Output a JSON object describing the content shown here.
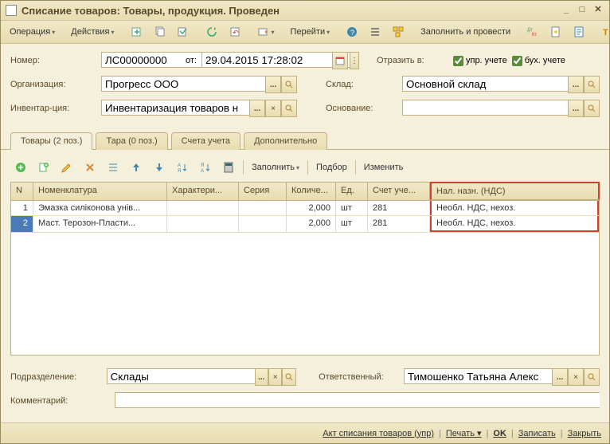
{
  "title": "Списание товаров: Товары, продукция. Проведен",
  "toolbar": {
    "operation": "Операция",
    "actions": "Действия",
    "goto": "Перейти",
    "fillpost": "Заполнить и провести"
  },
  "form": {
    "nomer_label": "Номер:",
    "nomer": "ЛС00000000",
    "ot_label": "от:",
    "date": "29.04.2015 17:28:02",
    "reflect_label": "Отразить в:",
    "chk_upr": "упр. учете",
    "chk_buh": "бух. учете",
    "org_label": "Организация:",
    "org": "Прогресс ООО",
    "sklad_label": "Склад:",
    "sklad": "Основной склад",
    "invent_label": "Инвентар-ция:",
    "invent": "Инвентаризация товаров н",
    "reason_label": "Основание:"
  },
  "tabs": {
    "goods": "Товары (2 поз.)",
    "tara": "Тара (0 поз.)",
    "accounts": "Счета учета",
    "extra": "Дополнительно"
  },
  "grid": {
    "toolbar": {
      "fill": "Заполнить",
      "select": "Подбор",
      "change": "Изменить"
    },
    "cols": {
      "n": "N",
      "nom": "Номенклатура",
      "char": "Характери...",
      "ser": "Серия",
      "qty": "Количе...",
      "unit": "Ед.",
      "acc": "Счет уче...",
      "vat": "Нал. назн. (НДС)"
    },
    "rows": [
      {
        "n": "1",
        "nom": "Эмазка силіконова унів...",
        "char": "",
        "ser": "",
        "qty": "2,000",
        "unit": "шт",
        "acc": "281",
        "vat": "Необл. НДС, нехоз."
      },
      {
        "n": "2",
        "nom": "Маст. Терозон-Пласти...",
        "char": "",
        "ser": "",
        "qty": "2,000",
        "unit": "шт",
        "acc": "281",
        "vat": "Необл. НДС, нехоз."
      }
    ]
  },
  "bottom": {
    "dept_label": "Подразделение:",
    "dept": "Склады",
    "resp_label": "Ответственный:",
    "resp": "Тимошенко Татьяна Алекс",
    "comment_label": "Комментарий:",
    "comment": ""
  },
  "status": {
    "act": "Акт списания товаров (упр)",
    "print": "Печать",
    "ok": "OK",
    "save": "Записать",
    "close": "Закрыть"
  }
}
